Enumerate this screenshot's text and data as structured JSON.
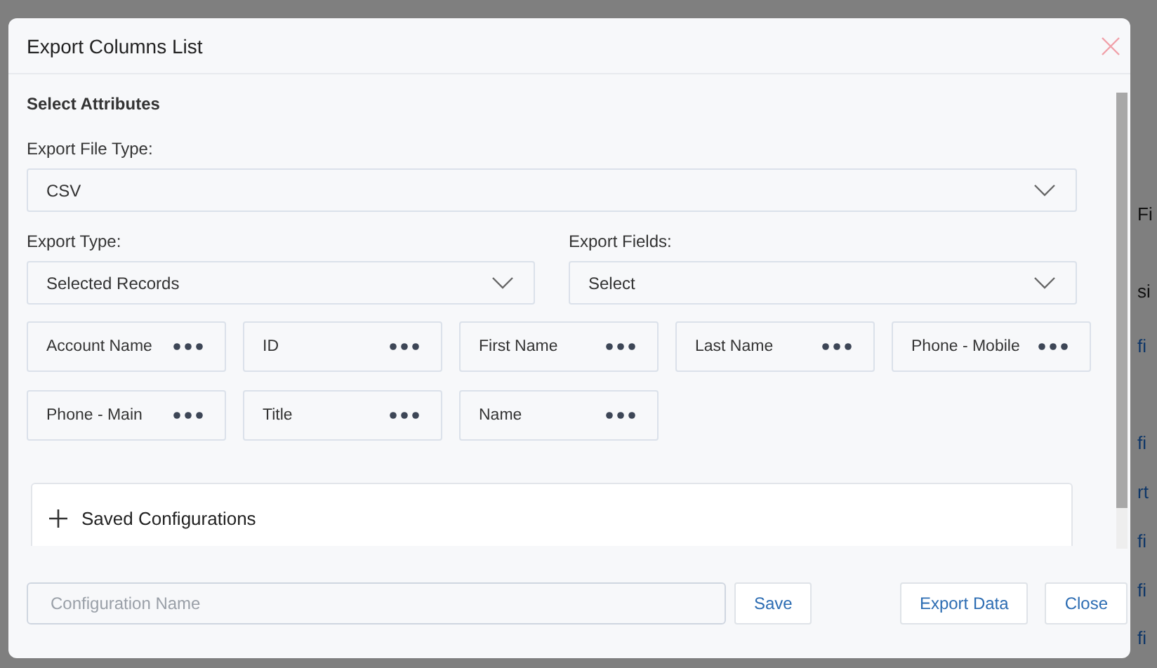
{
  "backdrop": {
    "fragments": [
      {
        "text": "Fi",
        "kind": "text"
      },
      {
        "text": "si",
        "kind": "text"
      },
      {
        "text": "fi",
        "kind": "link"
      },
      {
        "text": "fi",
        "kind": "link"
      },
      {
        "text": "rt",
        "kind": "link"
      },
      {
        "text": "fi",
        "kind": "link"
      },
      {
        "text": "fi",
        "kind": "link"
      },
      {
        "text": "fi",
        "kind": "link"
      }
    ]
  },
  "dialog": {
    "title": "Export Columns List",
    "section_title": "Select Attributes",
    "file_type": {
      "label": "Export File Type:",
      "value": "CSV"
    },
    "export_type": {
      "label": "Export Type:",
      "value": "Selected Records"
    },
    "export_fields": {
      "label": "Export Fields:",
      "value": "Select"
    },
    "columns": [
      {
        "label": "Account Name"
      },
      {
        "label": "ID"
      },
      {
        "label": "First Name"
      },
      {
        "label": "Last Name"
      },
      {
        "label": "Phone - Mobile"
      },
      {
        "label": "Phone - Main"
      },
      {
        "label": "Title"
      },
      {
        "label": "Name"
      }
    ],
    "saved_configurations": {
      "label": "Saved Configurations",
      "expanded": false
    },
    "footer": {
      "config_name": {
        "placeholder": "Configuration Name"
      },
      "save": "Save",
      "buttons": [
        "Export Data",
        "Close"
      ]
    }
  }
}
